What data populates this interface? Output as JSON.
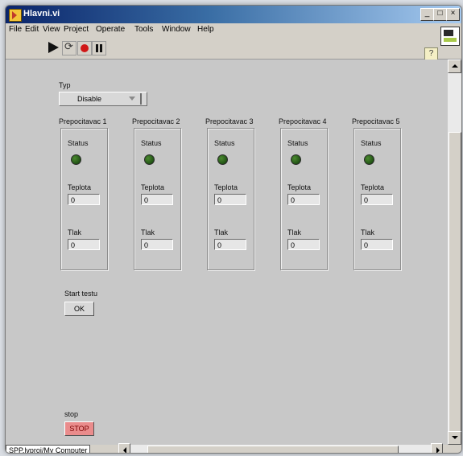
{
  "window": {
    "title": "Hlavni.vi"
  },
  "title_buttons": {
    "minimize": "_",
    "maximize": "□",
    "close": "×"
  },
  "menu": [
    "File",
    "Edit",
    "View",
    "Project",
    "Operate",
    "Tools",
    "Window",
    "Help"
  ],
  "toolbar": {
    "help_label": "?"
  },
  "panel": {
    "typ_label": "Typ",
    "typ_value": "Disable",
    "counters": [
      {
        "label": "Prepocitavac 1",
        "status_label": "Status",
        "temp_label": "Teplota",
        "temp_value": "0",
        "pressure_label": "Tlak",
        "pressure_value": "0"
      },
      {
        "label": "Prepocitavac 2",
        "status_label": "Status",
        "temp_label": "Teplota",
        "temp_value": "0",
        "pressure_label": "Tlak",
        "pressure_value": "0"
      },
      {
        "label": "Prepocitavac 3",
        "status_label": "Status",
        "temp_label": "Teplota",
        "temp_value": "0",
        "pressure_label": "Tlak",
        "pressure_value": "0"
      },
      {
        "label": "Prepocitavac 4",
        "status_label": "Status",
        "temp_label": "Teplota",
        "temp_value": "0",
        "pressure_label": "Tlak",
        "pressure_value": "0"
      },
      {
        "label": "Prepocitavac 5",
        "status_label": "Status",
        "temp_label": "Teplota",
        "temp_value": "0",
        "pressure_label": "Tlak",
        "pressure_value": "0"
      }
    ],
    "start_label": "Start testu",
    "ok_label": "OK",
    "stop_label": "stop",
    "stop_button": "STOP"
  },
  "statusbar": {
    "path": "SPP.lvproj/My Computer"
  },
  "colors": {
    "led_off": "#1f5a17",
    "stop_button": "#ea8c8c",
    "titlebar": "#0a246a"
  }
}
